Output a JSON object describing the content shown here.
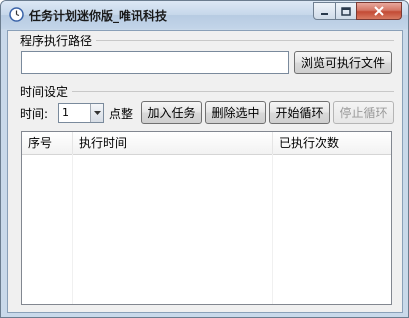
{
  "window": {
    "title": "任务计划迷你版_唯讯科技"
  },
  "path_section": {
    "label": "程序执行路径",
    "input_value": "",
    "browse_button": "浏览可执行文件"
  },
  "time_section": {
    "label": "时间设定",
    "time_label": "时间:",
    "hour_value": "1",
    "hour_suffix": "点整",
    "buttons": {
      "add": "加入任务",
      "delete": "删除选中",
      "start": "开始循环",
      "stop": "停止循环"
    }
  },
  "table": {
    "columns": [
      "序号",
      "执行时间",
      "已执行次数"
    ],
    "rows": []
  },
  "colors": {
    "titlebar": "#c6d7ea",
    "close_button": "#c34b35"
  }
}
